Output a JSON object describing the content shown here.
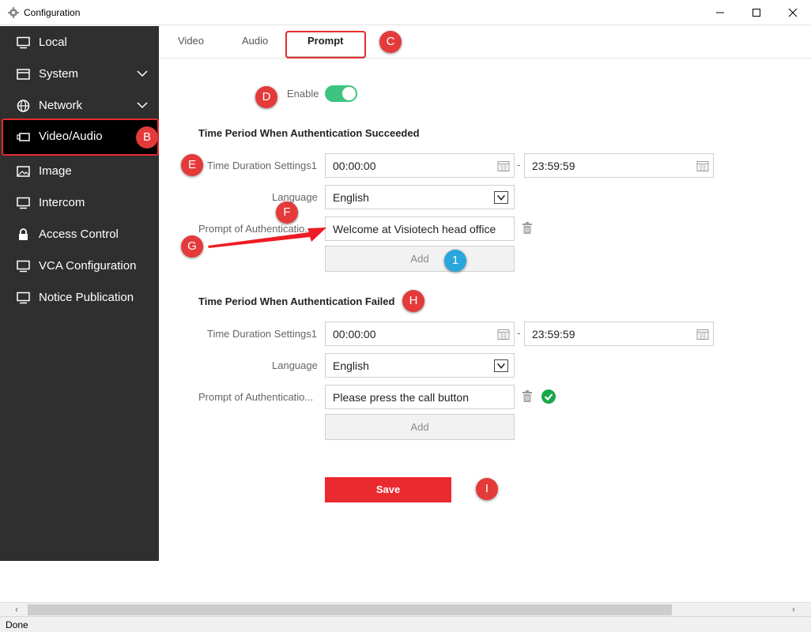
{
  "window": {
    "title": "Configuration",
    "minimize": "–",
    "maximize": "☐",
    "close": "✕"
  },
  "sidebar": {
    "items": [
      {
        "label": "Local",
        "icon": "monitor-icon"
      },
      {
        "label": "System",
        "icon": "window-icon",
        "expandable": true
      },
      {
        "label": "Network",
        "icon": "globe-icon",
        "expandable": true
      },
      {
        "label": "Video/Audio",
        "icon": "camera-icon",
        "active": true
      },
      {
        "label": "Image",
        "icon": "image-icon"
      },
      {
        "label": "Intercom",
        "icon": "monitor-icon"
      },
      {
        "label": "Access Control",
        "icon": "lock-icon"
      },
      {
        "label": "VCA Configuration",
        "icon": "monitor-icon"
      },
      {
        "label": "Notice Publication",
        "icon": "monitor-icon"
      }
    ]
  },
  "tabs": [
    {
      "label": "Video"
    },
    {
      "label": "Audio"
    },
    {
      "label": "Prompt",
      "active": true
    }
  ],
  "enable": {
    "label": "Enable",
    "on": true
  },
  "success": {
    "title": "Time Period When Authentication Succeeded",
    "duration_label": "Time Duration Settings1",
    "start": "00:00:00",
    "dash": "-",
    "end": "23:59:59",
    "language_label": "Language",
    "language": "English",
    "prompt_label": "Prompt of Authenticatio...",
    "prompt_value": "Welcome at Visiotech head office",
    "add_label": "Add"
  },
  "failed": {
    "title": "Time Period When Authentication Failed",
    "duration_label": "Time Duration Settings1",
    "start": "00:00:00",
    "dash": "-",
    "end": "23:59:59",
    "language_label": "Language",
    "language": "English",
    "prompt_label": "Prompt of Authenticatio...",
    "prompt_value": "Please press the call button",
    "add_label": "Add"
  },
  "save_label": "Save",
  "markers": {
    "B": "B",
    "C": "C",
    "D": "D",
    "E": "E",
    "F": "F",
    "G": "G",
    "H": "H",
    "I": "I",
    "one": "1"
  },
  "scroll": {
    "left": "‹",
    "right": "›"
  },
  "status": "Done",
  "colors": {
    "accent_red": "#ea2a2f",
    "toggle_green": "#3cc480",
    "sidebar_bg": "#2f2f2f",
    "check_green": "#1aa64a",
    "marker_red": "#e43a3a",
    "marker_blue": "#29a6dc"
  }
}
